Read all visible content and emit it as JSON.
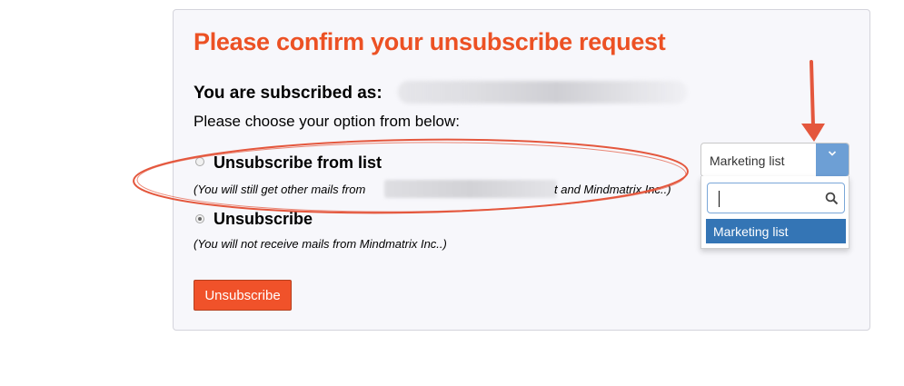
{
  "page": {
    "title": "Please confirm your unsubscribe request",
    "subscribed_label": "You are subscribed as:",
    "choose_prompt": "Please choose your option from below:"
  },
  "options": [
    {
      "label": "Unsubscribe from list",
      "note_prefix": "(You will still get other mails from",
      "note_suffix": "t and Mindmatrix Inc..)",
      "selected": false
    },
    {
      "label": "Unsubscribe",
      "note": "(You will not receive mails from Mindmatrix Inc..)",
      "selected": true
    }
  ],
  "submit": {
    "label": "Unsubscribe"
  },
  "list_select": {
    "selected_value": "Marketing list",
    "search_value": "",
    "options": [
      "Marketing list"
    ]
  },
  "colors": {
    "title": "#ec5124",
    "button": "#f0522a",
    "select_accent": "#6d9fd5",
    "option_highlight": "#3475b5",
    "annotation": "#e4573d"
  },
  "icons": {
    "select_arrow": "chevron-down-icon",
    "search": "search-icon"
  }
}
